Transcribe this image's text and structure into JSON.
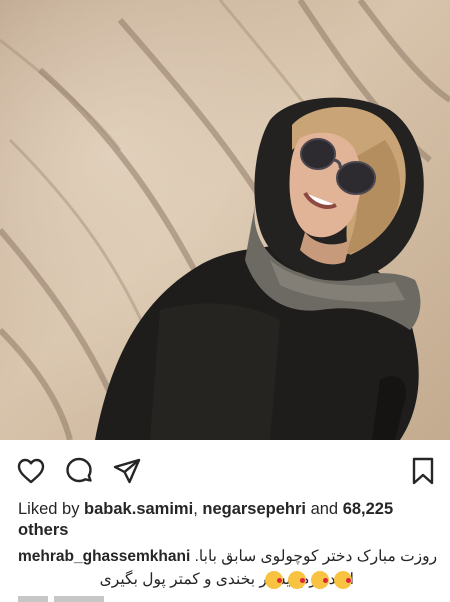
{
  "post": {
    "image_alt": "Woman wearing sunglasses and a headscarf smiling on a sandy hillside",
    "actions": {
      "like_icon": "heart-icon",
      "comment_icon": "comment-icon",
      "share_icon": "send-icon",
      "save_icon": "bookmark-icon"
    },
    "likes": {
      "prefix": "Liked by ",
      "user1": "babak.samimi",
      "sep": ", ",
      "user2": "negarsepehri",
      "and": " and ",
      "count": "68,225",
      "others": "others"
    },
    "caption": {
      "username": "mehrab_ghassemkhani",
      "line1": "روزت مبارک دختر کوچولوی سابق بابا.",
      "line2": "امیدوارم بیشتر بخندی و کمتر پول بگیری",
      "emoji_name": "kissing-face-emoji",
      "emoji_count": 4
    }
  },
  "colors": {
    "text": "#262626",
    "muted": "#8e8e8e",
    "background": "#ffffff"
  }
}
